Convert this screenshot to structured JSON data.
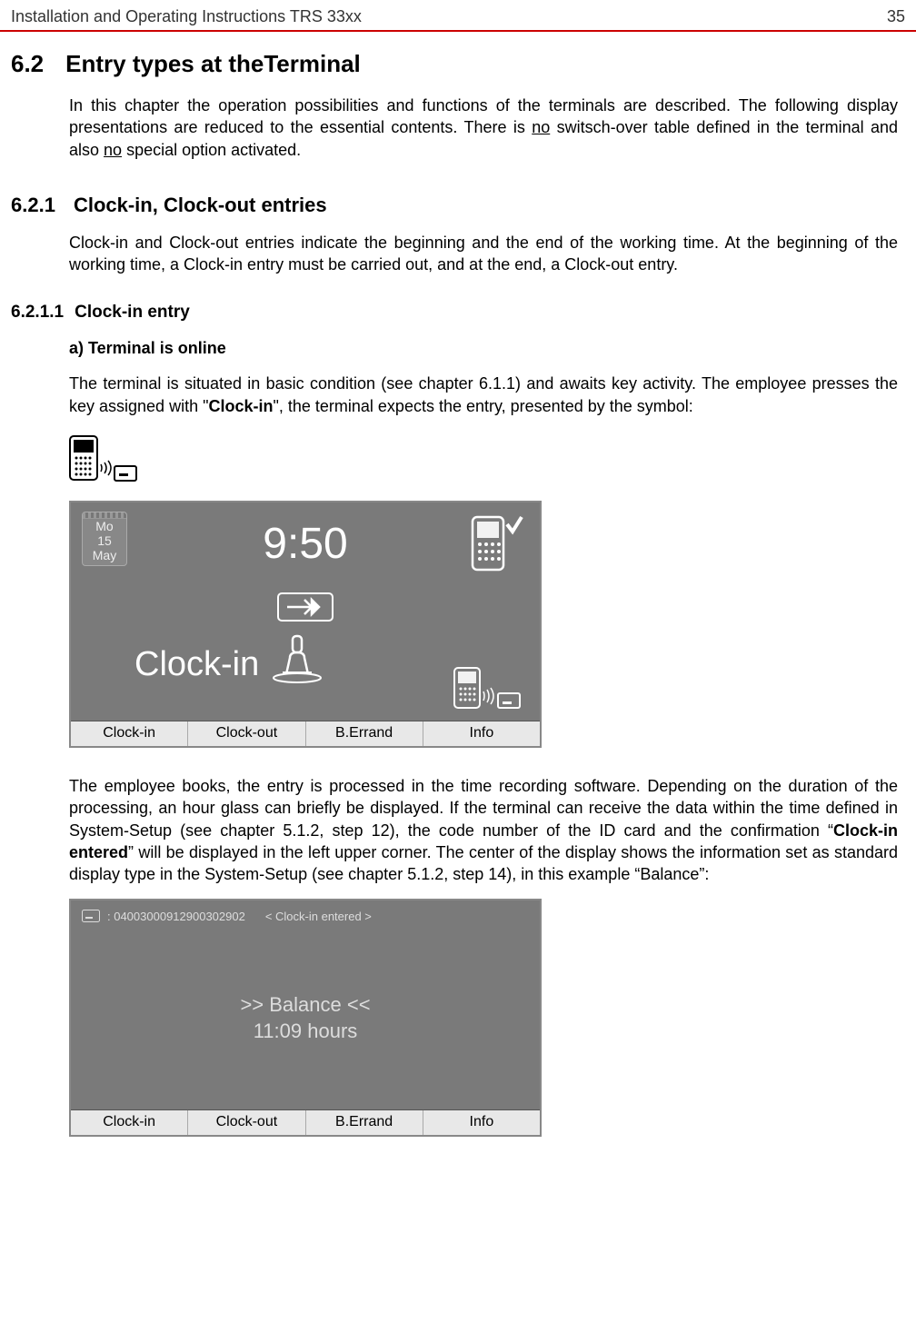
{
  "header": {
    "title": "Installation and Operating Instructions TRS 33xx",
    "page": "35"
  },
  "section62": {
    "num": "6.2",
    "title": "Entry types at theTerminal",
    "intro_a": "In this chapter the operation possibilities and functions of the terminals are described. The following display presentations are reduced to the essential contents. There is ",
    "intro_no1": "no",
    "intro_b": " switsch-over table defined in the terminal and also ",
    "intro_no2": "no",
    "intro_c": " special option activated."
  },
  "section621": {
    "num": "6.2.1",
    "title": "Clock-in, Clock-out entries",
    "body": "Clock-in and Clock-out entries indicate the beginning and the end of the working time. At the beginning of the working time, a Clock-in entry must be carried out, and at the end, a Clock-out entry."
  },
  "section6211": {
    "num": "6.2.1.1",
    "title": "Clock-in entry",
    "a_heading": "a) Terminal is online",
    "a_p1_a": "The terminal is situated in basic condition (see chapter 6.1.1) and awaits  key activity. The employee presses the key assigned with \"",
    "a_p1_bold": "Clock-in",
    "a_p1_b": "\", the terminal expects the entry, presented by the symbol:",
    "a_p2_a": "The employee books, the entry is processed in the time recording software. Depending on the duration of the processing, an hour glass can briefly be displayed. If the terminal can receive the data within the time defined in System-Setup (see chapter 5.1.2, step 12), the code number of the ID card and the confirmation “",
    "a_p2_bold": "Clock-in entered",
    "a_p2_b": "” will be displayed in the left upper corner. The center of the display shows the information set as standard display type in the System-Setup (see chapter 5.1.2, step 14), in this example “Balance”:"
  },
  "screen1": {
    "day": "Mo",
    "date": "15",
    "month": "May",
    "time": "9:50",
    "action": "Clock-in",
    "buttons": [
      "Clock-in",
      "Clock-out",
      "B.Errand",
      "Info"
    ]
  },
  "screen2": {
    "id": ": 04003000912900302902",
    "status": "<  Clock-in entered  >",
    "center_l1": ">> Balance <<",
    "center_l2": "11:09 hours",
    "buttons": [
      "Clock-in",
      "Clock-out",
      "B.Errand",
      "Info"
    ]
  }
}
